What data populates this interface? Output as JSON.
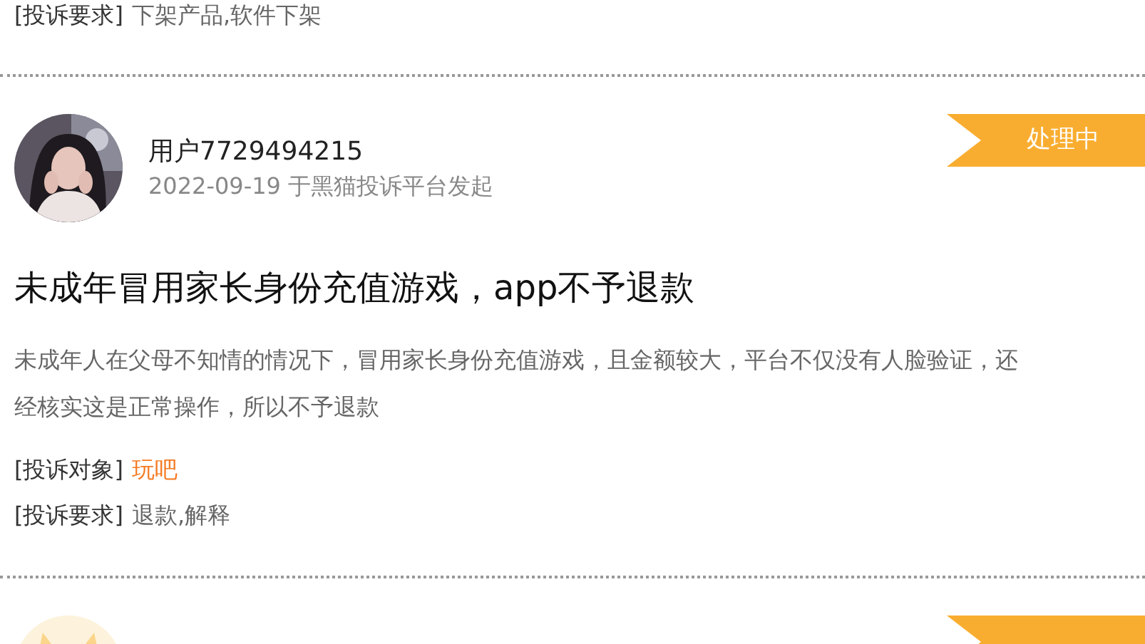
{
  "complaints": [
    {
      "kind": "tail",
      "fields": [
        {
          "label": "[投诉要求]",
          "value": "下架产品,软件下架",
          "kind": "plain"
        }
      ]
    },
    {
      "kind": "full",
      "avatar": {
        "kind": "picture"
      },
      "user": "用户7729494215",
      "meta": "2022-09-19 于黑猫投诉平台发起",
      "status": "处理中",
      "title": "未成年冒用家长身份充值游戏，app不予退款",
      "description_lines": [
        "未成年人在父母不知情的情况下，冒用家长身份充值游戏，且金额较大，平台不仅没有人脸验证，还",
        "经核实这是正常操作，所以不予退款"
      ],
      "fields": [
        {
          "label": "[投诉对象]",
          "value": "玩吧",
          "kind": "link"
        },
        {
          "label": "[投诉要求]",
          "value": "退款,解释",
          "kind": "plain"
        }
      ]
    },
    {
      "kind": "head",
      "avatar": {
        "kind": "icon"
      },
      "ribbon": {
        "kind": "status"
      }
    }
  ]
}
